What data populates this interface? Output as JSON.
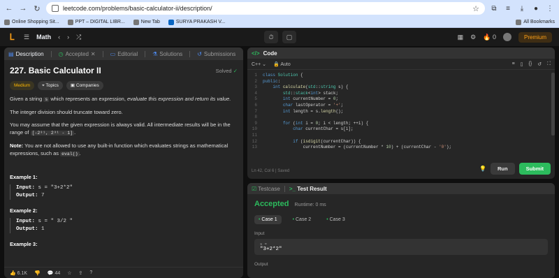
{
  "browser": {
    "url": "leetcode.com/problems/basic-calculator-ii/description/",
    "bookmarks": [
      "Online Shopping Sit...",
      "PPT – DIGITAL LIBR...",
      "New Tab",
      "SURYA PRAKASH V..."
    ],
    "all_bookmarks": "All Bookmarks"
  },
  "nav": {
    "title": "Math",
    "streak": "0",
    "premium": "Premium"
  },
  "left": {
    "tabs": [
      "Description",
      "Accepted",
      "Editorial",
      "Solutions",
      "Submissions"
    ],
    "title": "227. Basic Calculator II",
    "solved": "Solved",
    "chips": [
      "Medium",
      "Topics",
      "Companies"
    ],
    "p1a": "Given a string ",
    "p1code": "s",
    "p1b": " which represents an expression, ",
    "p1em": "evaluate this expression and return its value.",
    "p2": "The integer division should truncate toward zero.",
    "p3": "You may assume that the given expression is always valid. All intermediate results will be in the range of ",
    "p3code": "[-2³¹, 2³¹ - 1]",
    "p3end": ".",
    "note_label": "Note:",
    "note": " You are not allowed to use any built-in function which evaluates strings as mathematical expressions, such as ",
    "note_code": "eval()",
    "note_end": ".",
    "examples": [
      {
        "title": "Example 1:",
        "input_label": "Input:",
        "input": " s = \"3+2*2\"",
        "output_label": "Output:",
        "output": " 7"
      },
      {
        "title": "Example 2:",
        "input_label": "Input:",
        "input": " s = \" 3/2 \"",
        "output_label": "Output:",
        "output": " 1"
      },
      {
        "title": "Example 3:"
      }
    ],
    "likes": "6.1K",
    "comments": "44"
  },
  "code": {
    "header": "Code",
    "language": "C++",
    "mode": "Auto",
    "status": "Ln 42, Col 6   |   Saved",
    "run": "Run",
    "submit": "Submit"
  },
  "test": {
    "tab1": "Testcase",
    "tab2": "Test Result",
    "verdict": "Accepted",
    "runtime": "Runtime: 0 ms",
    "cases": [
      "Case 1",
      "Case 2",
      "Case 3"
    ],
    "input_label": "Input",
    "var_name": "s =",
    "var_value": "\"3+2*2\"",
    "output_label": "Output"
  }
}
